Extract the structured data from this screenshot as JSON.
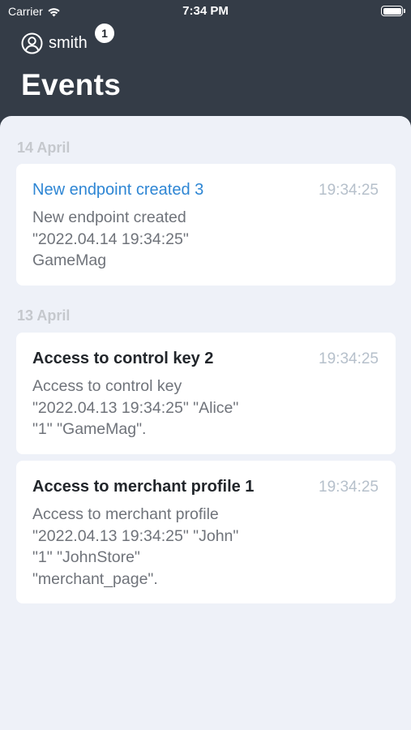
{
  "status_bar": {
    "carrier": "Carrier",
    "time": "7:34 PM"
  },
  "header": {
    "user_name": "smith",
    "notification_count": "1",
    "title": "Events"
  },
  "sections": [
    {
      "date": "14 April",
      "events": [
        {
          "title": "New endpoint created 3",
          "time": "19:34:25",
          "body": "New endpoint created\n\"2022.04.14 19:34:25\"\nGameMag",
          "accent": true
        }
      ]
    },
    {
      "date": "13 April",
      "events": [
        {
          "title": "Access to control key 2",
          "time": "19:34:25",
          "body": "Access to control key\n\"2022.04.13 19:34:25\" \"Alice\"\n\"1\" \"GameMag\".",
          "accent": false
        },
        {
          "title": "Access to merchant profile 1",
          "time": "19:34:25",
          "body": "Access to merchant profile\n\"2022.04.13 19:34:25\" \"John\"\n\"1\" \"JohnStore\"\n\"merchant_page\".",
          "accent": false
        }
      ]
    }
  ],
  "colors": {
    "header_bg": "#343c47",
    "content_bg": "#eef1f8",
    "accent": "#2e86d4",
    "section_header": "#c5c8cd",
    "time_text": "#b6c0cb"
  },
  "icons": {
    "wifi": "wifi-icon",
    "battery": "battery-icon",
    "user": "user-circle-icon"
  }
}
